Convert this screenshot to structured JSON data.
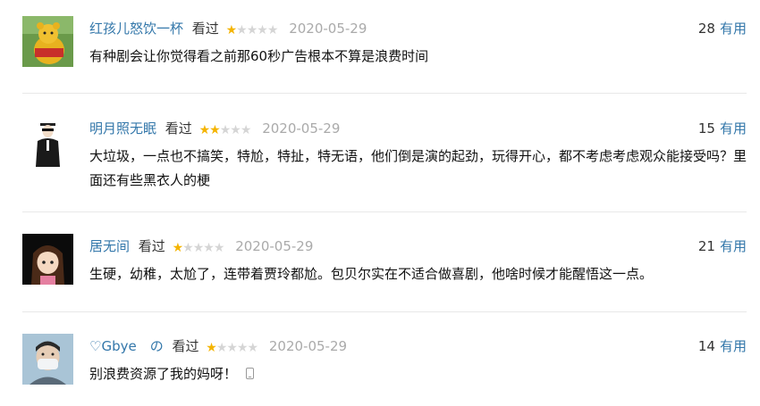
{
  "comments": [
    {
      "user": "红孩儿怒饮一杯",
      "status": "看过",
      "rating": 1,
      "date": "2020-05-29",
      "votes": "28",
      "useful_label": "有用",
      "content": "有种剧会让你觉得看之前那60秒广告根本不算是浪费时间"
    },
    {
      "user": "明月照无眠",
      "status": "看过",
      "rating": 2,
      "date": "2020-05-29",
      "votes": "15",
      "useful_label": "有用",
      "content": "大垃圾，一点也不搞笑，特尬，特扯，特无语，他们倒是演的起劲，玩得开心，都不考虑考虑观众能接受吗？里面还有些黑衣人的梗"
    },
    {
      "user": "居无间",
      "status": "看过",
      "rating": 1,
      "date": "2020-05-29",
      "votes": "21",
      "useful_label": "有用",
      "content": "生硬，幼稚，太尬了，连带着贾玲都尬。包贝尔实在不适合做喜剧，他啥时候才能醒悟这一点。"
    },
    {
      "user": "♡Gbye　の",
      "status": "看过",
      "rating": 1,
      "date": "2020-05-29",
      "votes": "14",
      "useful_label": "有用",
      "content": "别浪费资源了我的妈呀！"
    }
  ],
  "max_rating": 5,
  "colors": {
    "link": "#3377aa",
    "star_on": "#f4b400",
    "star_off": "#d5d5d5"
  }
}
